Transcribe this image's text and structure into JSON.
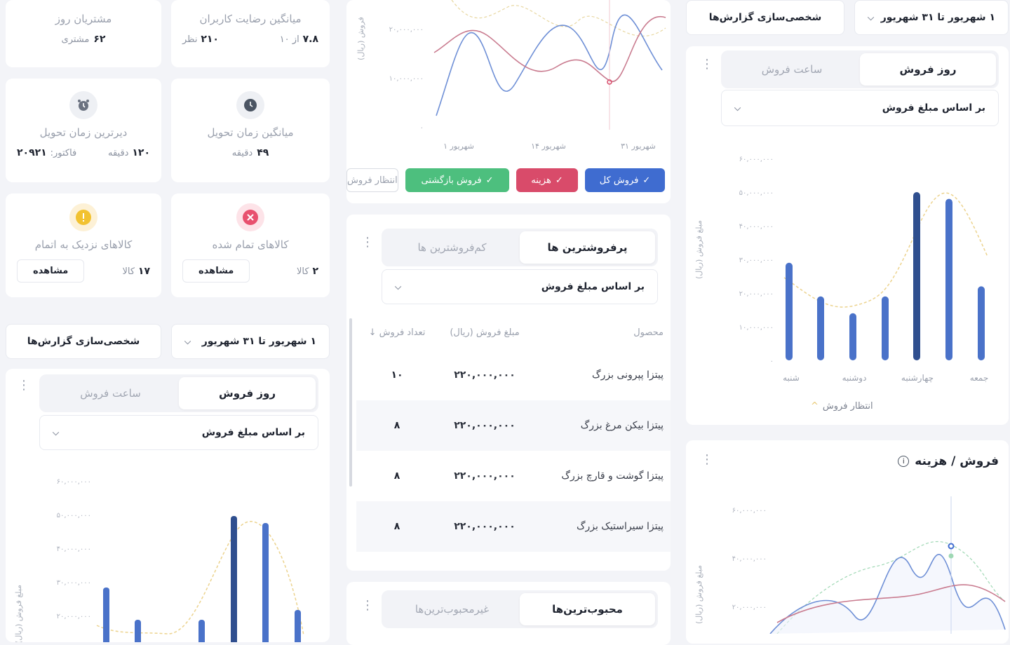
{
  "left_stats": {
    "customers": {
      "title": "مشتریان روز",
      "value": "۶۲",
      "unit": "مشتری"
    },
    "satisfaction": {
      "title": "میانگین رضایت کاربران",
      "score": "۷.۸",
      "of": "از ۱۰",
      "count": "۲۱۰",
      "count_unit": "نظر"
    },
    "latest_delivery": {
      "title": "دیرترین زمان تحویل",
      "minutes": "۱۲۰",
      "minutes_unit": "دقیقه",
      "invoice_label": "فاکتور:",
      "invoice": "۲۰۹۲۱"
    },
    "avg_delivery": {
      "title": "میانگین زمان تحویل",
      "minutes": "۴۹",
      "minutes_unit": "دقیقه"
    },
    "near_out": {
      "title": "کالاهای نزدیک به اتمام",
      "count": "۱۷",
      "unit": "کالا",
      "button": "مشاهده"
    },
    "out_of_stock": {
      "title": "کالاهای تمام شده",
      "count": "۲",
      "unit": "کالا",
      "button": "مشاهده"
    }
  },
  "filters": {
    "date_range": "۱ شهریور تا ۳۱ شهریور",
    "customize": "شخصی‌سازی گزارش‌ها"
  },
  "sales_card": {
    "tab_day": "روز فروش",
    "tab_hour": "ساعت فروش",
    "sort": "بر اساس مبلغ فروش",
    "expected_legend": "انتظار فروش",
    "ylabel": "مبلغ فروش (ریال)"
  },
  "left_chart": {
    "yticks": [
      "۶۰,۰۰۰,۰۰۰",
      "۵۰,۰۰۰,۰۰۰",
      "۴۰,۰۰۰,۰۰۰",
      "۳۰,۰۰۰,۰۰۰",
      "۲۰,۰۰۰,۰۰۰"
    ],
    "ylabel": "مبلغ فروش (ریال)"
  },
  "middle_line_chart": {
    "yticks": [
      "۲۰,۰۰۰,۰۰۰",
      "۱۰,۰۰۰,۰۰۰",
      "۰"
    ],
    "xticks": [
      "۱ شهریور",
      "۱۴ شهریور",
      "۳۱ شهریور"
    ],
    "ylabel": "فروش (ریال)",
    "legend": {
      "total": "فروش کل",
      "cost": "هزینه",
      "returns": "فروش بازگشتی",
      "expected": "انتظار فروش"
    }
  },
  "products_card": {
    "tab_best": "پرفروشترین ها",
    "tab_worst": "کم‌فروشترین ها",
    "sort": "بر اساس مبلغ فروش",
    "headers": {
      "product": "محصول",
      "amount": "مبلغ فروش (ریال)",
      "count": "تعداد فروش"
    },
    "rows": [
      {
        "name": "پیتزا پپرونی بزرگ",
        "amount": "۲۲۰,۰۰۰,۰۰۰",
        "count": "۱۰"
      },
      {
        "name": "پیتزا بیکن مرغ بزرگ",
        "amount": "۲۲۰,۰۰۰,۰۰۰",
        "count": "۸"
      },
      {
        "name": "پیتزا گوشت و قارچ بزرگ",
        "amount": "۲۲۰,۰۰۰,۰۰۰",
        "count": "۸"
      },
      {
        "name": "پیتزا سیراستیک بزرگ",
        "amount": "۲۲۰,۰۰۰,۰۰۰",
        "count": "۸"
      }
    ]
  },
  "favorites_card": {
    "tab_fav": "محبوب‌ترین‌ها",
    "tab_unfav": "غیرمحبوب‌ترین‌ها"
  },
  "right_chart": {
    "yticks": [
      "۶۰,۰۰۰,۰۰۰",
      "۵۰,۰۰۰,۰۰۰",
      "۴۰,۰۰۰,۰۰۰",
      "۳۰,۰۰۰,۰۰۰",
      "۲۰,۰۰۰,۰۰۰",
      "۱۰,۰۰۰,۰۰۰",
      "۰"
    ],
    "xticks": [
      "شنبه",
      "دوشنبه",
      "چهارشنبه",
      "جمعه"
    ]
  },
  "sales_cost_card": {
    "title": "فروش / هزینه",
    "yticks": [
      "۶۰,۰۰۰,۰۰۰",
      "۴۰,۰۰۰,۰۰۰",
      "۲۰,۰۰۰,۰۰۰"
    ],
    "ylabel": "مبلغ فروش (ریال)"
  },
  "colors": {
    "primary": "#4a72c9",
    "dark_bar": "#2f4f8f",
    "cost": "#d94b6a",
    "returns": "#4dbf7e",
    "expected": "#e8c770"
  },
  "chart_data": [
    {
      "type": "bar",
      "categories": [
        "شنبه",
        "",
        "دوشنبه",
        "",
        "چهارشنبه",
        "",
        "جمعه"
      ],
      "values": [
        29000000,
        19000000,
        14000000,
        19000000,
        50000000,
        48000000,
        22000000
      ],
      "ylim": [
        0,
        60000000
      ],
      "ylabel": "مبلغ فروش (ریال)",
      "legend": [
        "انتظار فروش"
      ]
    }
  ]
}
